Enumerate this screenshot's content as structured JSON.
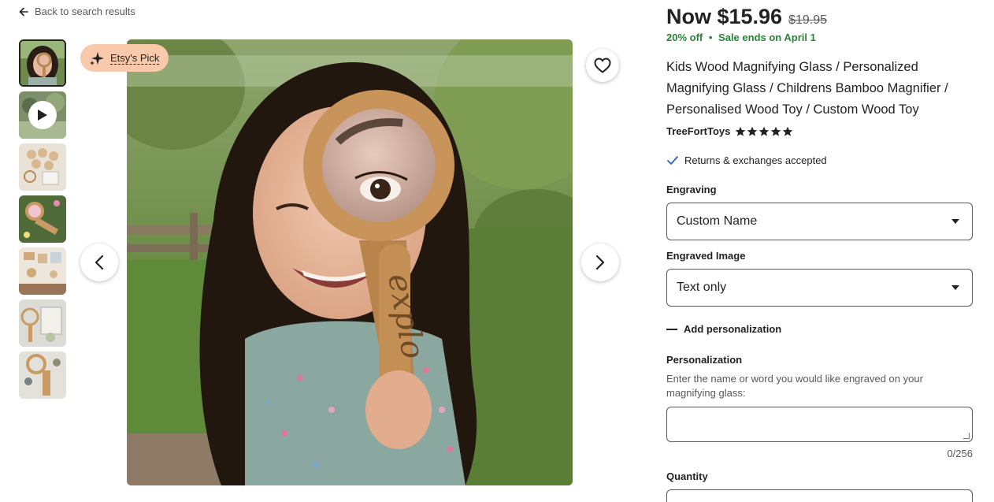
{
  "nav": {
    "back_label": "Back to search results"
  },
  "gallery": {
    "badge_label": "Etsy's Pick",
    "thumbnails": [
      {
        "name": "thumb-girl-magnifier",
        "active": true
      },
      {
        "name": "thumb-video",
        "video": true
      },
      {
        "name": "thumb-wood-set"
      },
      {
        "name": "thumb-magnifier-flowers"
      },
      {
        "name": "thumb-wood-pieces"
      },
      {
        "name": "thumb-magnifier-kit"
      },
      {
        "name": "thumb-magnifier-toy"
      }
    ],
    "main_image_text": "explo"
  },
  "product": {
    "price_now": "Now $15.96",
    "price_old": "$19.95",
    "discount": "20% off",
    "sale_separator": "•",
    "sale_end": "Sale ends on April 1",
    "title": "Kids Wood Magnifying Glass / Personalized Magnifying Glass / Childrens Bamboo Magnifier / Personalised Wood Toy / Custom Wood Toy",
    "shop_name": "TreeFortToys",
    "rating_stars": 5,
    "returns_text": "Returns & exchanges accepted"
  },
  "options": {
    "engraving_label": "Engraving",
    "engraving_value": "Custom Name",
    "image_label": "Engraved Image",
    "image_value": "Text only",
    "add_personalization": "Add personalization",
    "personalization_label": "Personalization",
    "personalization_desc": "Enter the name or word you would like engraved on your magnifying glass:",
    "personalization_value": "",
    "counter": "0/256",
    "quantity_label": "Quantity"
  },
  "colors": {
    "sale_green": "#258635",
    "badge_peach": "#f8c9aa",
    "check_blue": "#2f66b3"
  }
}
